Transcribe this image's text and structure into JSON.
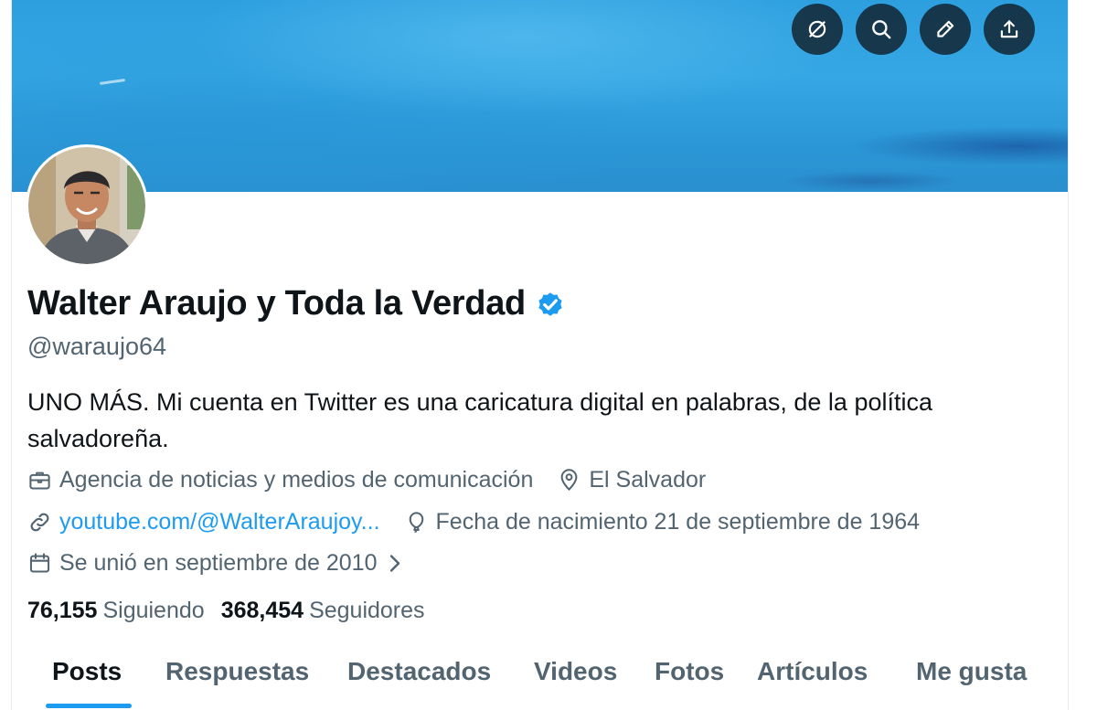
{
  "header": {
    "actions": [
      {
        "name": "grok-icon",
        "label": "Grok"
      },
      {
        "name": "search-icon",
        "label": "Buscar"
      },
      {
        "name": "edit-icon",
        "label": "Editar"
      },
      {
        "name": "share-icon",
        "label": "Compartir"
      }
    ]
  },
  "profile": {
    "display_name": "Walter Araujo y Toda la Verdad",
    "handle": "@waraujo64",
    "bio": "UNO MÁS. Mi cuenta en Twitter es una caricatura digital en palabras, de la política salvadoreña.",
    "category": "Agencia de noticias y medios de comunicación",
    "location": "El Salvador",
    "website": "youtube.com/@WalterAraujoy...",
    "birthday": "Fecha de nacimiento 21 de septiembre de 1964",
    "joined": "Se unió en septiembre de 2010",
    "following_count": "76,155",
    "following_label": "Siguiendo",
    "followers_count": "368,454",
    "followers_label": "Seguidores"
  },
  "tabs": [
    {
      "label": "Posts",
      "active": true
    },
    {
      "label": "Respuestas",
      "active": false
    },
    {
      "label": "Destacados",
      "active": false
    },
    {
      "label": "Videos",
      "active": false
    },
    {
      "label": "Fotos",
      "active": false
    },
    {
      "label": "Artículos",
      "active": false
    },
    {
      "label": "Me gusta",
      "active": false
    }
  ],
  "colors": {
    "accent": "#1d9bf0",
    "text_primary": "#0f1419",
    "text_secondary": "#536471",
    "verified_badge": "#1d9bf0"
  }
}
